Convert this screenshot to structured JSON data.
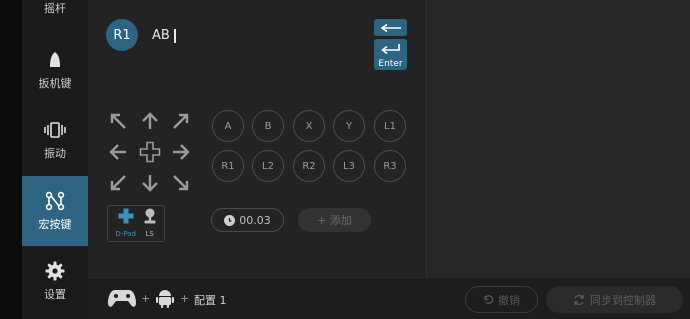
{
  "sidebar": {
    "items": [
      {
        "label": "摇杆",
        "icon": "joystick-icon"
      },
      {
        "label": "扳机键",
        "icon": "trigger-icon"
      },
      {
        "label": "振动",
        "icon": "vibration-icon"
      },
      {
        "label": "宏按键",
        "icon": "macro-icon",
        "active": true
      },
      {
        "label": "设置",
        "icon": "gear-icon"
      }
    ]
  },
  "macro": {
    "key_badge": "R1",
    "sequence": "AB"
  },
  "controls": {
    "backspace_icon": "backspace-arrow-icon",
    "enter_label": "Enter"
  },
  "buttons": {
    "row1": [
      "A",
      "B",
      "X",
      "Y",
      "L1"
    ],
    "row2": [
      "R1",
      "L2",
      "R2",
      "L3",
      "R3"
    ]
  },
  "input_box": {
    "dpad_label": "D-Pad",
    "ls_label": "LS"
  },
  "delay": {
    "value": "00.03"
  },
  "add": {
    "label": "+ 添加"
  },
  "footer": {
    "config_label": "配置 1",
    "revert_label": "撤销",
    "sync_label": "同步到控制器",
    "plus": "+"
  },
  "colors": {
    "accent": "#2d6481",
    "background": "#242424",
    "sidebar": "#1a1a1a"
  }
}
